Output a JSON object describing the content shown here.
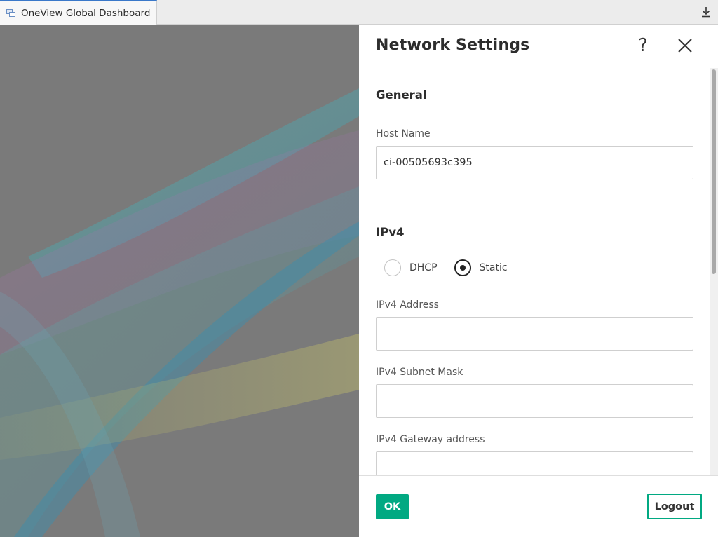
{
  "tab": {
    "title": "OneView Global Dashboard",
    "icon": "dashboard-window-icon"
  },
  "toolbar": {
    "download_icon": "download-icon"
  },
  "panel": {
    "title": "Network Settings",
    "help_label": "?",
    "close_icon": "close-icon",
    "general": {
      "section_title": "General",
      "host_name_label": "Host Name",
      "host_name_value": "ci-00505693c395"
    },
    "ipv4": {
      "section_title": "IPv4",
      "mode_options": [
        {
          "label": "DHCP",
          "selected": false
        },
        {
          "label": "Static",
          "selected": true
        }
      ],
      "address_label": "IPv4 Address",
      "address_value": "",
      "subnet_label": "IPv4 Subnet Mask",
      "subnet_value": "",
      "gateway_label": "IPv4 Gateway address",
      "gateway_value": ""
    },
    "footer": {
      "ok_label": "OK",
      "logout_label": "Logout"
    }
  },
  "colors": {
    "accent": "#01a982",
    "backdrop": "#7a7a7a",
    "tab_indicator": "#3a78c9"
  }
}
